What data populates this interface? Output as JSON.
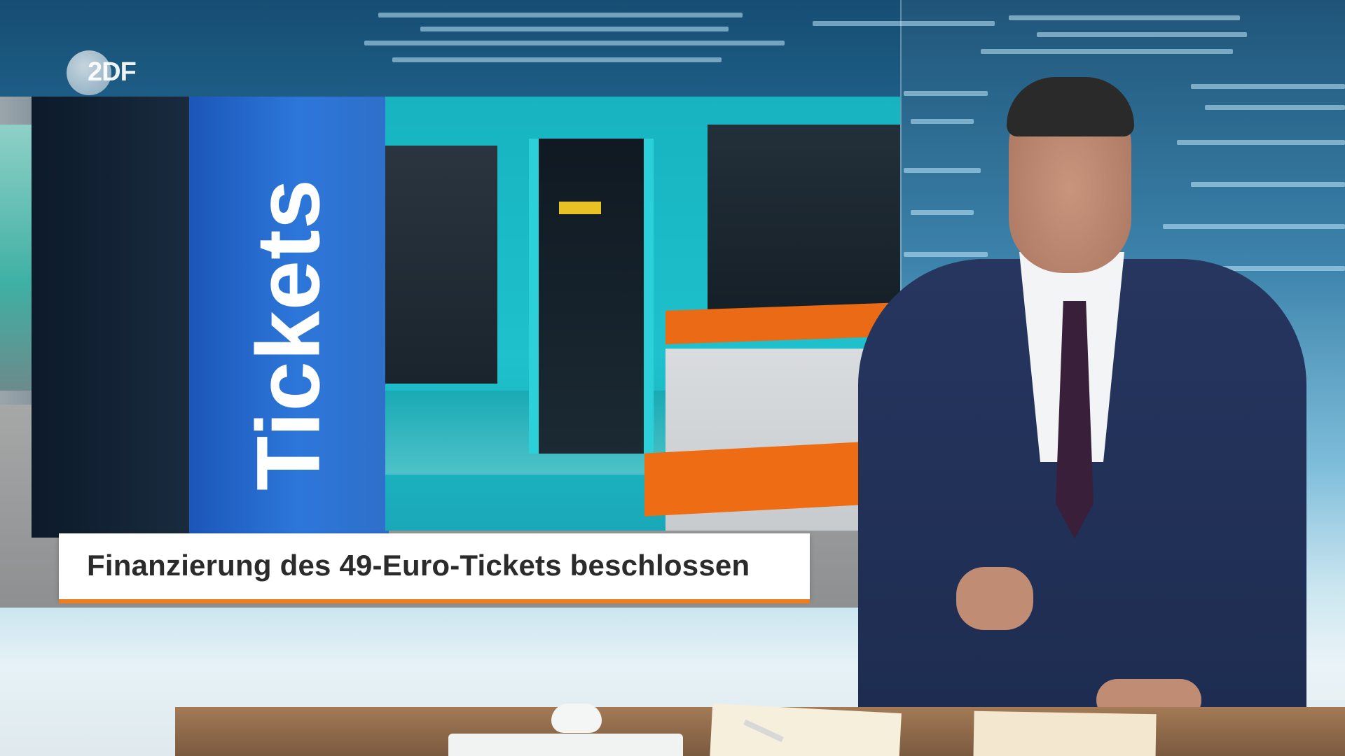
{
  "channel": {
    "logo_text": "2DF"
  },
  "graphic": {
    "photo_sign_text": "Tickets",
    "headline": "Finanzierung des 49-Euro-Tickets beschlossen",
    "accent_color": "#f07d1a"
  },
  "colors": {
    "studio_background": "#2a78a4",
    "sign_blue": "#2d77da",
    "train_teal": "#1ec1cc",
    "train_orange": "#ee6c14"
  }
}
